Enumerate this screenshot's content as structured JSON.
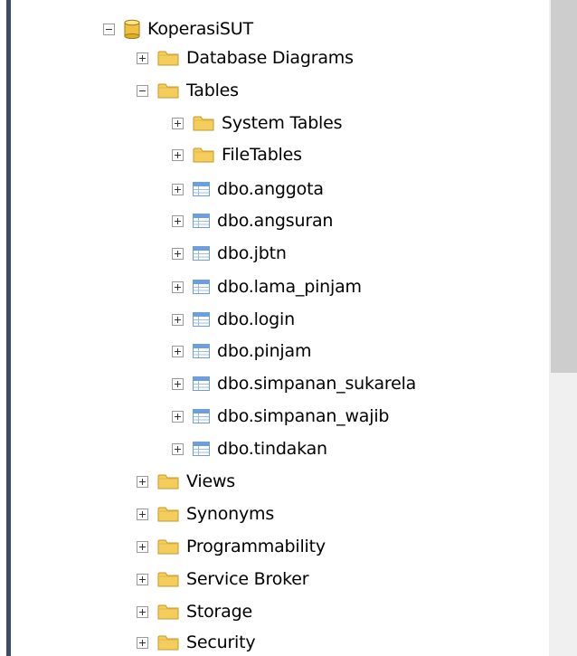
{
  "tree": {
    "database": {
      "label": "KoperasiSUT",
      "icon": "database-icon",
      "expanded": true
    },
    "database_diagrams": {
      "label": "Database Diagrams",
      "icon": "folder-icon"
    },
    "tables": {
      "label": "Tables",
      "icon": "folder-icon",
      "expanded": true,
      "folders": [
        {
          "label": "System Tables",
          "icon": "folder-icon"
        },
        {
          "label": "FileTables",
          "icon": "folder-icon"
        }
      ],
      "items": [
        {
          "label": "dbo.anggota",
          "icon": "table-icon"
        },
        {
          "label": "dbo.angsuran",
          "icon": "table-icon"
        },
        {
          "label": "dbo.jbtn",
          "icon": "table-icon"
        },
        {
          "label": "dbo.lama_pinjam",
          "icon": "table-icon"
        },
        {
          "label": "dbo.login",
          "icon": "table-icon"
        },
        {
          "label": "dbo.pinjam",
          "icon": "table-icon"
        },
        {
          "label": "dbo.simpanan_sukarela",
          "icon": "table-icon"
        },
        {
          "label": "dbo.simpanan_wajib",
          "icon": "table-icon"
        },
        {
          "label": "dbo.tindakan",
          "icon": "table-icon"
        }
      ]
    },
    "folders": [
      {
        "label": "Views",
        "icon": "folder-icon"
      },
      {
        "label": "Synonyms",
        "icon": "folder-icon"
      },
      {
        "label": "Programmability",
        "icon": "folder-icon"
      },
      {
        "label": "Service Broker",
        "icon": "folder-icon"
      },
      {
        "label": "Storage",
        "icon": "folder-icon"
      },
      {
        "label": "Security",
        "icon": "folder-icon"
      }
    ]
  },
  "colors": {
    "folder": "#f5cd5c",
    "table_header": "#6d9ee0",
    "database": "#f0c040",
    "left_bar": "#3d4a6b"
  }
}
